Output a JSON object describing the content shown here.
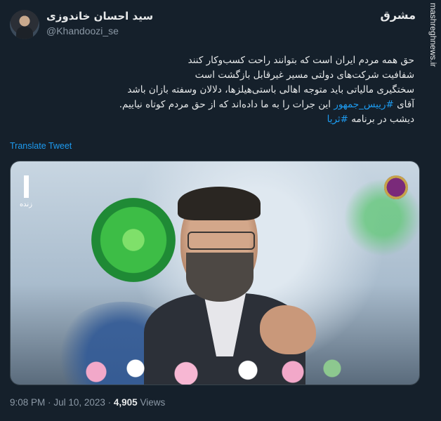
{
  "author": {
    "display_name": "سید احسان خاندوزی",
    "handle": "@Khandoozi_se"
  },
  "watermark": {
    "vertical_text": "mashreghnews.ir",
    "logo_text": "مشرق"
  },
  "tweet": {
    "lines": [
      "حق همه مردم ایران است که بتوانند راحت کسب‌وکار کنند",
      "شفافیت شرکت‌های دولتی مسیر غیرقابل بازگشت است",
      "سختگیری مالیاتی باید متوجه اهالی باستی‌هیلزها، دلالان وسفته بازان باشد"
    ],
    "line4_prefix": "آقای",
    "line4_hashtag": "#رییس_جمهور",
    "line4_suffix": "این جرات را به ما داده‌اند که از حق مردم کوتاه نیاییم.",
    "line5_prefix": "دیشب در برنامه",
    "line5_hashtag": "#ثریا"
  },
  "translate_label": "Translate Tweet",
  "media": {
    "live_label": "زنده"
  },
  "meta": {
    "time": "9:08 PM",
    "separator": "·",
    "date": "Jul 10, 2023",
    "views_count": "4,905",
    "views_label": "Views"
  },
  "colors": {
    "background": "#15202b",
    "text": "#e7e9ea",
    "muted": "#8b98a5",
    "link": "#1d9bf0"
  }
}
